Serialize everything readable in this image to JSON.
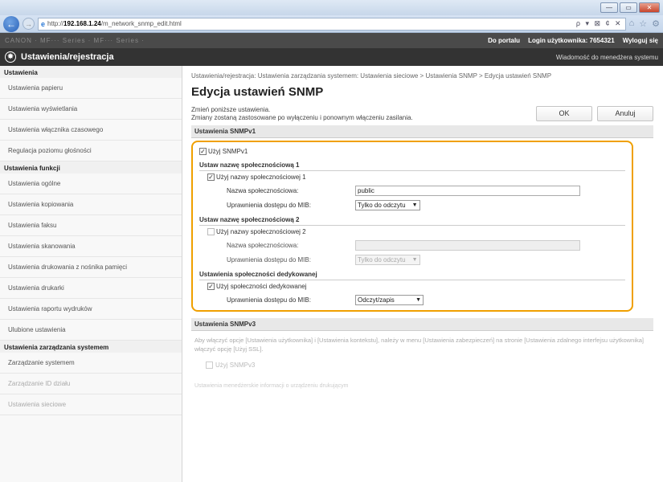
{
  "browser": {
    "url_prefix": "http://",
    "url_host": "192.168.1.24",
    "url_path": "/m_network_snmp_edit.html",
    "addr_controls": "ρ ▾ ⊠ ¢ ✕",
    "tb_icons": [
      "⌂",
      "☆",
      "⚙"
    ],
    "win": [
      "—",
      "▭",
      "✕"
    ]
  },
  "topbar": {
    "left_blurred": "CANON ·   MF··· Series · MF··· Series ·",
    "portal": "Do portalu",
    "login_label": "Login użytkownika:",
    "login_value": "7654321",
    "logout": "Wyloguj się"
  },
  "title": {
    "app_title": "Ustawienia/rejestracja",
    "manager_msg": "Wiadomość do menedżera systemu"
  },
  "sidebar": {
    "sections": [
      {
        "title": "Ustawienia",
        "items": [
          "Ustawienia papieru",
          "Ustawienia wyświetlania",
          "Ustawienia włącznika czasowego",
          "Regulacja poziomu głośności"
        ]
      },
      {
        "title": "Ustawienia funkcji",
        "items": [
          "Ustawienia ogólne",
          "Ustawienia kopiowania",
          "Ustawienia faksu",
          "Ustawienia skanowania",
          "Ustawienia drukowania z nośnika pamięci",
          "Ustawienia drukarki",
          "Ustawienia raportu wydruków",
          "Ulubione ustawienia"
        ]
      },
      {
        "title": "Ustawienia zarządzania systemem",
        "items": [
          "Zarządzanie systemem",
          "Zarządzanie ID działu",
          "Ustawienia sieciowe"
        ]
      }
    ]
  },
  "main": {
    "breadcrumb": "Ustawienia/rejestracja: Ustawienia zarządzania systemem: Ustawienia sieciowe > Ustawienia SNMP > Edycja ustawień SNMP",
    "page_title": "Edycja ustawień SNMP",
    "intro_line1": "Zmień poniższe ustawienia.",
    "intro_line2": "Zmiany zostaną zastosowane po wyłączeniu i ponownym włączeniu zasilania.",
    "ok": "OK",
    "cancel": "Anuluj",
    "snmpv1_header": "Ustawienia SNMPv1",
    "use_snmpv1": "Użyj SNMPv1",
    "community1_head": "Ustaw nazwę społecznościową 1",
    "use_community1": "Użyj nazwy społecznościowej 1",
    "community_name_label": "Nazwa społecznościowa:",
    "community1_value": "public",
    "mib_access_label": "Uprawnienia dostępu do MIB:",
    "mib1_value": "Tylko do odczytu",
    "community2_head": "Ustaw nazwę społecznościową 2",
    "use_community2": "Użyj nazwy społecznościowej 2",
    "community2_value": "",
    "mib2_value": "Tylko do odczytu",
    "dedicated_head": "Ustawienia społeczności dedykowanej",
    "use_dedicated": "Użyj społeczności dedykowanej",
    "mib3_value": "Odczyt/zapis",
    "check_mark": "✓",
    "snmpv3_header": "Ustawienia SNMPv3",
    "snmpv3_note": "Aby włączyć opcje [Ustawienia użytkownika] i [Ustawienia kontekstu], należy w menu [Ustawienia zabezpieczeń] na stronie [Ustawienia zdalnego interfejsu użytkownika] włączyć opcję [Użyj SSL].",
    "use_snmpv3": "Użyj SNMPv3",
    "bottom_faded": "Ustawienia menedżerskie informacji o urządzeniu drukującym"
  }
}
